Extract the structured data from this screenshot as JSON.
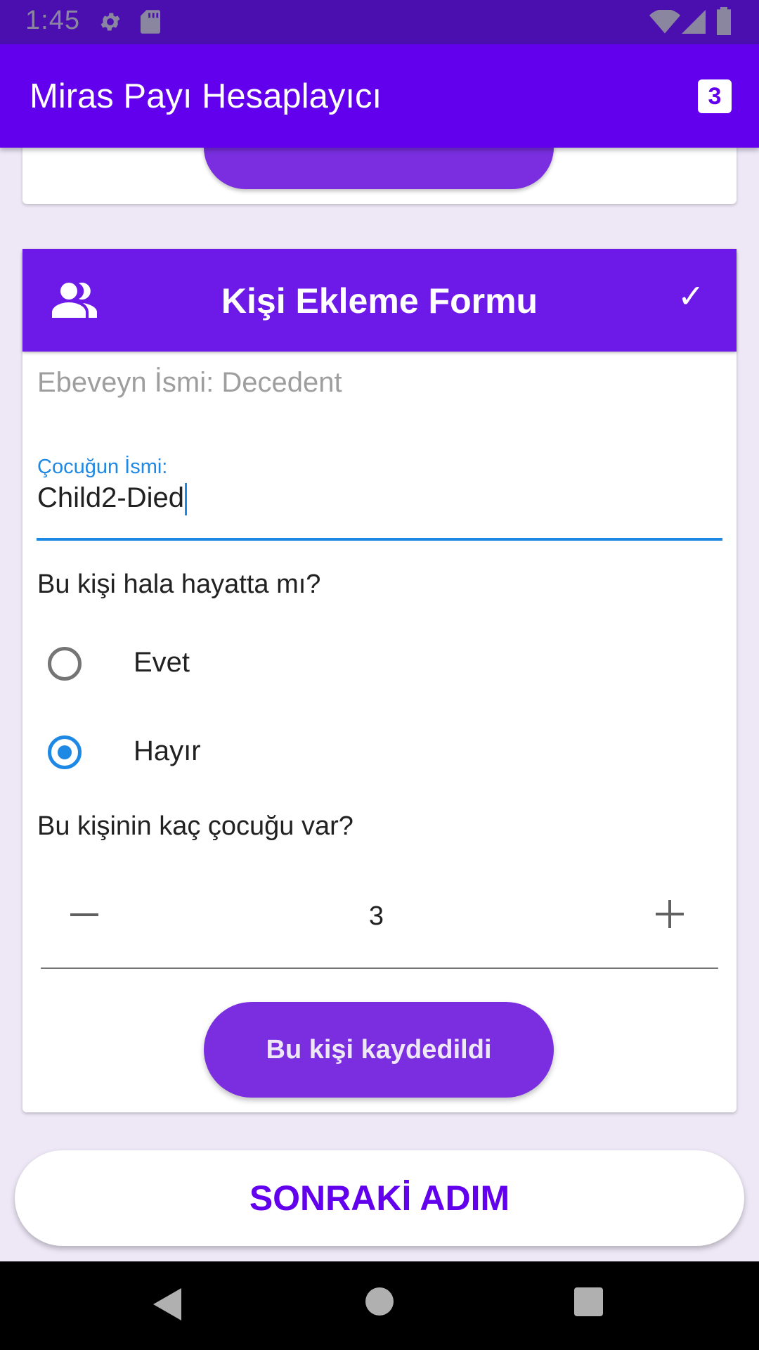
{
  "status_bar": {
    "time": "1:45",
    "icons": [
      "settings-icon",
      "sd-card-icon",
      "wifi-icon",
      "signal-icon",
      "battery-icon"
    ]
  },
  "app_bar": {
    "title": "Miras Payı Hesaplayıcı",
    "badge": "3"
  },
  "previous_card": {
    "save_label": "Bu kişi kaydedildi"
  },
  "form": {
    "header_icon": "people-icon",
    "title": "Kişi Ekleme Formu",
    "check": "✓",
    "parent_label": "Ebeveyn İsmi: Decedent",
    "child_name_label": "Çocuğun İsmi:",
    "child_name_value": "Child2-Died",
    "alive_question": "Bu kişi hala hayatta mı?",
    "options": [
      {
        "label": "Evet",
        "selected": false
      },
      {
        "label": "Hayır",
        "selected": true
      }
    ],
    "children_question": "Bu kişinin kaç çocuğu var?",
    "children_count": "3",
    "save_label": "Bu kişi kaydedildi"
  },
  "next_button": "SONRAKİ ADIM",
  "colors": {
    "primary": "#6200ee",
    "header": "#6d19e8",
    "button": "#7a2ee0",
    "accent": "#1e88e5",
    "background": "#ede7f6"
  }
}
